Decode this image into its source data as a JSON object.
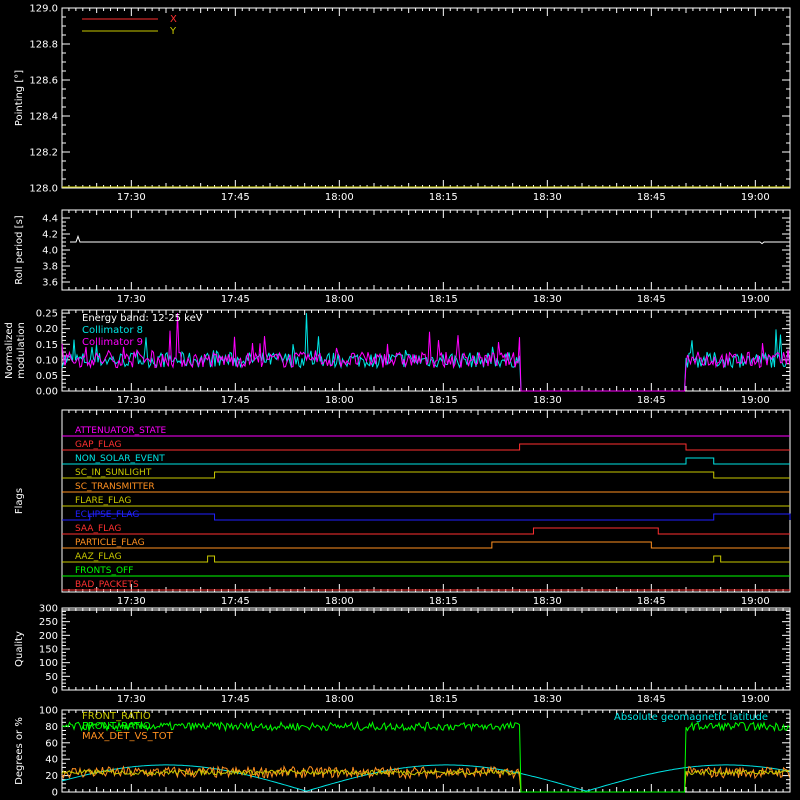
{
  "colors": {
    "background": "#000000",
    "axes": "#ffffff",
    "red": "#ff3030",
    "yellow": "#c8c800",
    "cyan": "#00e5e5",
    "magenta": "#ff00ff",
    "green": "#00ff00",
    "orange": "#ff9020",
    "blue": "#2020ff"
  },
  "time_ticks": [
    "17:30",
    "17:45",
    "18:00",
    "18:15",
    "18:30",
    "18:45",
    "19:00"
  ],
  "chart_data": [
    {
      "type": "line",
      "ylabel": "Pointing [°]",
      "ylim": [
        128.0,
        129.0
      ],
      "yticks": [
        "128.0",
        "128.2",
        "128.4",
        "128.6",
        "128.8",
        "129.0"
      ],
      "legend": [
        {
          "name": "X",
          "color": "red"
        },
        {
          "name": "Y",
          "color": "yellow"
        }
      ],
      "series": [
        {
          "name": "Y",
          "color": "yellow",
          "flat": 128.0
        }
      ]
    },
    {
      "type": "line",
      "ylabel": "Roll period [s]",
      "ylim": [
        3.5,
        4.5
      ],
      "yticks": [
        "3.6",
        "3.8",
        "4.0",
        "4.2",
        "4.4"
      ],
      "series": [
        {
          "color": "white",
          "flat": 4.1
        }
      ]
    },
    {
      "type": "line",
      "ylabel": [
        "Normalized",
        "modulation"
      ],
      "ylim": [
        0.0,
        0.26
      ],
      "yticks": [
        "0.00",
        "0.05",
        "0.10",
        "0.15",
        "0.20",
        "0.25"
      ],
      "legend": [
        {
          "name": "Energy band: 12-25 keV",
          "color": "white"
        },
        {
          "name": "Collimator 8",
          "color": "cyan"
        },
        {
          "name": "Collimator 9",
          "color": "magenta"
        }
      ],
      "gap": [
        "18:26",
        "18:50"
      ]
    },
    {
      "type": "line",
      "ylabel": "Flags",
      "flags": [
        {
          "name": "ATTENUATOR_STATE",
          "color": "magenta",
          "steps": []
        },
        {
          "name": "GAP_FLAG",
          "color": "red",
          "steps": [
            [
              "18:26",
              "18:50"
            ]
          ]
        },
        {
          "name": "NON_SOLAR_EVENT",
          "color": "cyan",
          "steps": [
            [
              "18:50",
              "18:54"
            ]
          ]
        },
        {
          "name": "SC_IN_SUNLIGHT",
          "color": "yellow",
          "steps": [
            [
              "17:42",
              "18:54"
            ]
          ]
        },
        {
          "name": "SC_TRANSMITTER",
          "color": "orange",
          "steps": []
        },
        {
          "name": "FLARE_FLAG",
          "color": "yellow",
          "steps": []
        },
        {
          "name": "ECLIPSE_FLAG",
          "color": "blue",
          "steps": [
            [
              "17:24",
              "17:42"
            ],
            [
              "18:54",
              "19:05"
            ]
          ]
        },
        {
          "name": "SAA_FLAG",
          "color": "red",
          "steps": [
            [
              "18:28",
              "18:46"
            ]
          ]
        },
        {
          "name": "PARTICLE_FLAG",
          "color": "orange",
          "steps": [
            [
              "18:22",
              "18:45"
            ]
          ]
        },
        {
          "name": "AAZ_FLAG",
          "color": "yellow",
          "steps": [
            [
              "17:41",
              "17:42"
            ],
            [
              "18:54",
              "18:55"
            ]
          ]
        },
        {
          "name": "FRONTS_OFF",
          "color": "green",
          "steps": []
        },
        {
          "name": "BAD_PACKETS",
          "color": "red",
          "steps": []
        }
      ]
    },
    {
      "type": "line",
      "ylabel": "Quality",
      "ylim": [
        0,
        300
      ],
      "yticks": [
        "0",
        "50",
        "100",
        "150",
        "200",
        "250",
        "300"
      ]
    },
    {
      "type": "line",
      "ylabel": "Degrees or %",
      "ylim": [
        0,
        100
      ],
      "yticks": [
        "0",
        "20",
        "40",
        "60",
        "80",
        "100"
      ],
      "legend": [
        {
          "name": "FRONT_RATIO",
          "color": "yellow"
        },
        {
          "name": "FRONT_RATIO",
          "color": "green"
        },
        {
          "name": "MAX_DET_VS_TOT",
          "color": "orange"
        }
      ],
      "annotation": {
        "text": "Absolute geomagnetic latitude",
        "color": "cyan"
      },
      "gap": [
        "18:26",
        "18:50"
      ]
    }
  ]
}
